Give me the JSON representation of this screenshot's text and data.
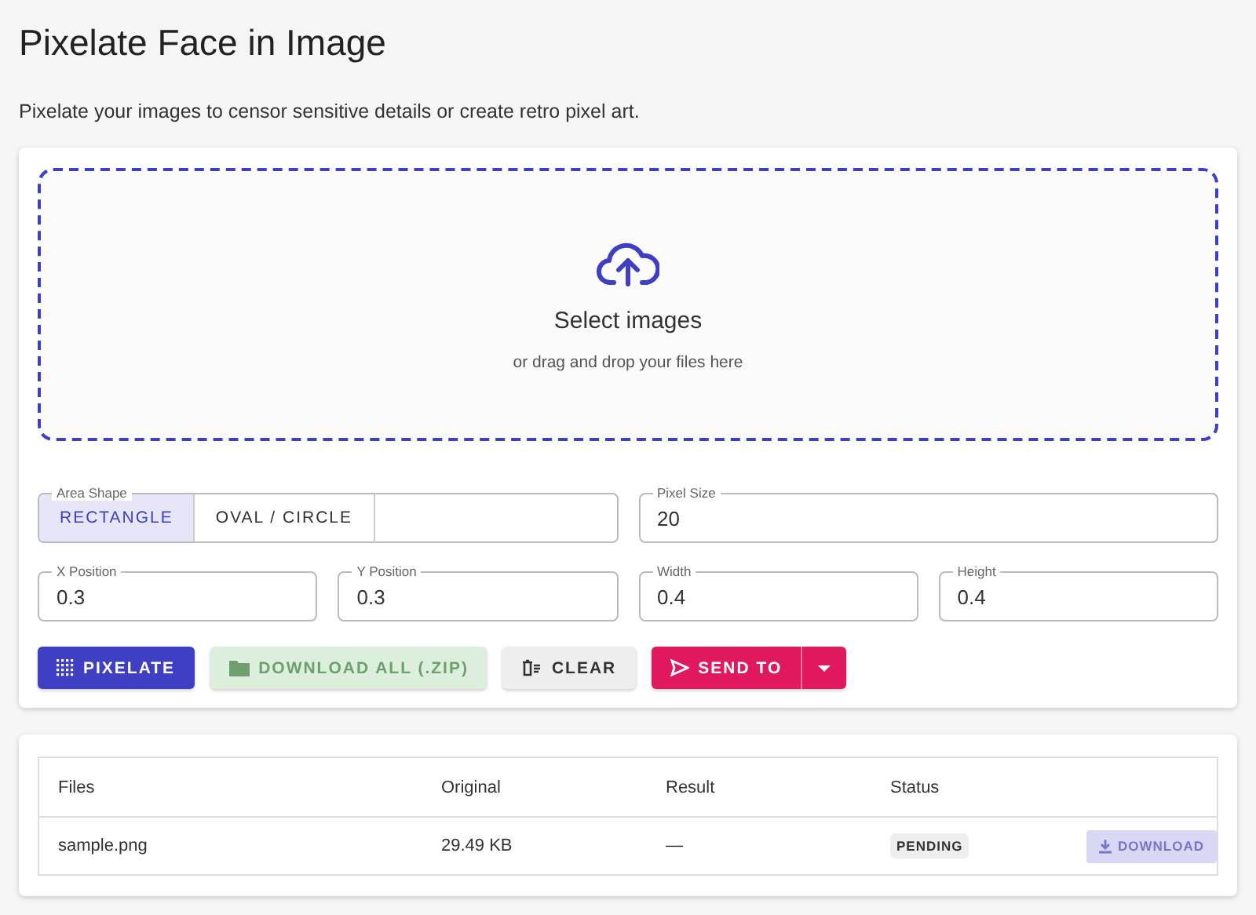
{
  "page": {
    "title": "Pixelate Face in Image",
    "subtitle": "Pixelate your images to censor sensitive details or create retro pixel art."
  },
  "dropzone": {
    "title": "Select images",
    "hint": "or drag and drop your files here"
  },
  "area_shape": {
    "label": "Area Shape",
    "options": [
      {
        "label": "RECTANGLE",
        "selected": true
      },
      {
        "label": "OVAL / CIRCLE",
        "selected": false
      }
    ]
  },
  "pixel_size": {
    "label": "Pixel Size",
    "value": "20"
  },
  "position_fields": [
    {
      "label": "X Position",
      "value": "0.3"
    },
    {
      "label": "Y Position",
      "value": "0.3"
    },
    {
      "label": "Width",
      "value": "0.4"
    },
    {
      "label": "Height",
      "value": "0.4"
    }
  ],
  "actions": [
    {
      "kind": "pixelate",
      "label": "PIXELATE",
      "disabled": false
    },
    {
      "kind": "download",
      "label": "DOWNLOAD ALL (.ZIP)",
      "disabled": true
    },
    {
      "kind": "clear",
      "label": "CLEAR",
      "disabled": false
    },
    {
      "kind": "send",
      "label": "SEND TO",
      "disabled": false
    }
  ],
  "table": {
    "columns": [
      "Files",
      "Original",
      "Result",
      "Status"
    ],
    "rows": [
      {
        "file": "sample.png",
        "original": "29.49 KB",
        "result": "—",
        "status": "PENDING",
        "action": {
          "label": "DOWNLOAD",
          "disabled": true
        }
      }
    ]
  }
}
